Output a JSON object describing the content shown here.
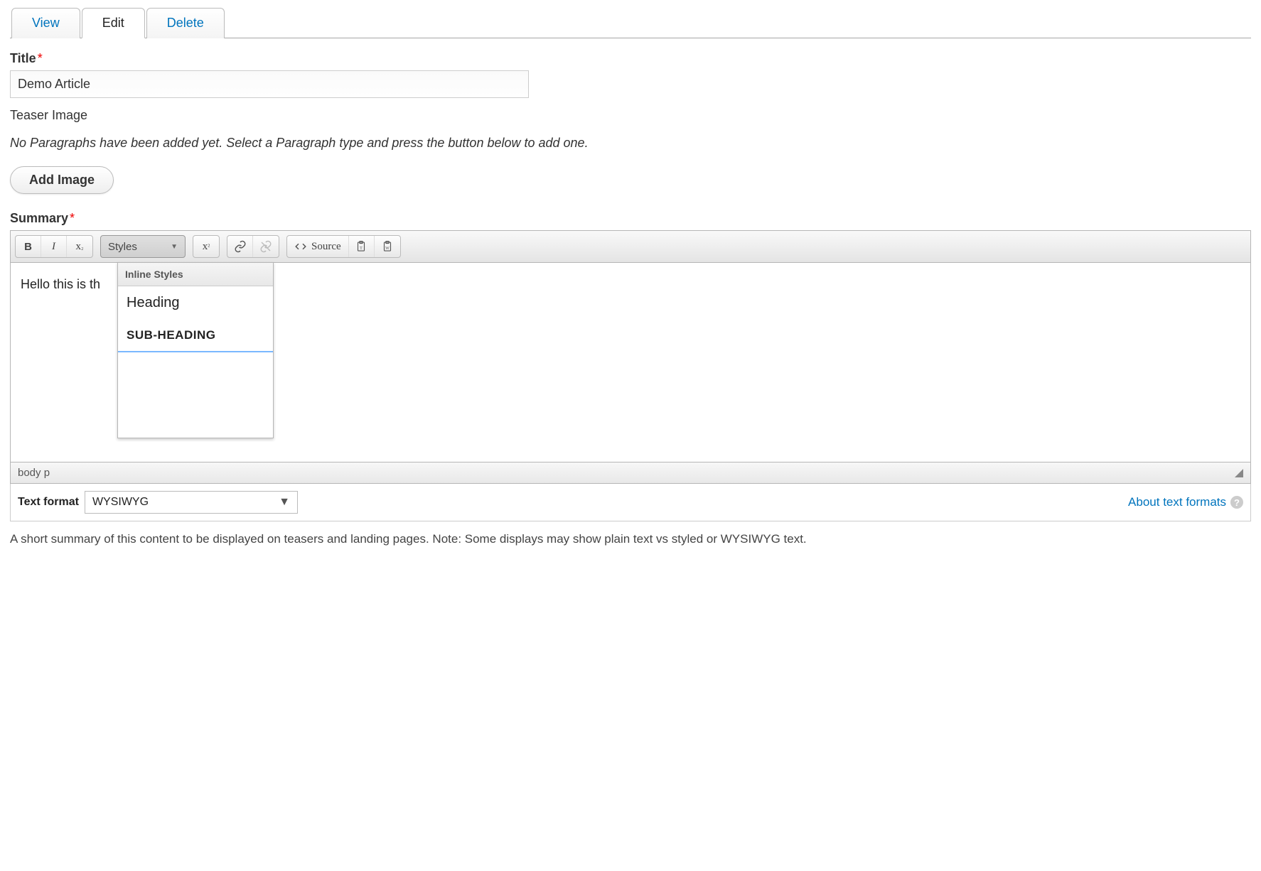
{
  "tabs": {
    "view": "View",
    "edit": "Edit",
    "delete": "Delete",
    "active": "edit"
  },
  "title": {
    "label": "Title",
    "value": "Demo Article"
  },
  "teaser": {
    "label": "Teaser Image",
    "empty_msg": "No Paragraphs have been added yet. Select a Paragraph type and press the button below to add one.",
    "add_button": "Add Image"
  },
  "summary": {
    "label": "Summary",
    "content": "Hello this is th",
    "path": "body   p"
  },
  "toolbar": {
    "styles_label": "Styles",
    "source_label": "Source"
  },
  "styles_dropdown": {
    "header": "Inline Styles",
    "items": [
      "Heading",
      "SUB-HEADING"
    ]
  },
  "text_format": {
    "label": "Text format",
    "value": "WYSIWYG",
    "about_link": "About text formats"
  },
  "help_text": "A short summary of this content to be displayed on teasers and landing pages. Note: Some displays may show plain text vs styled or WYSIWYG text."
}
